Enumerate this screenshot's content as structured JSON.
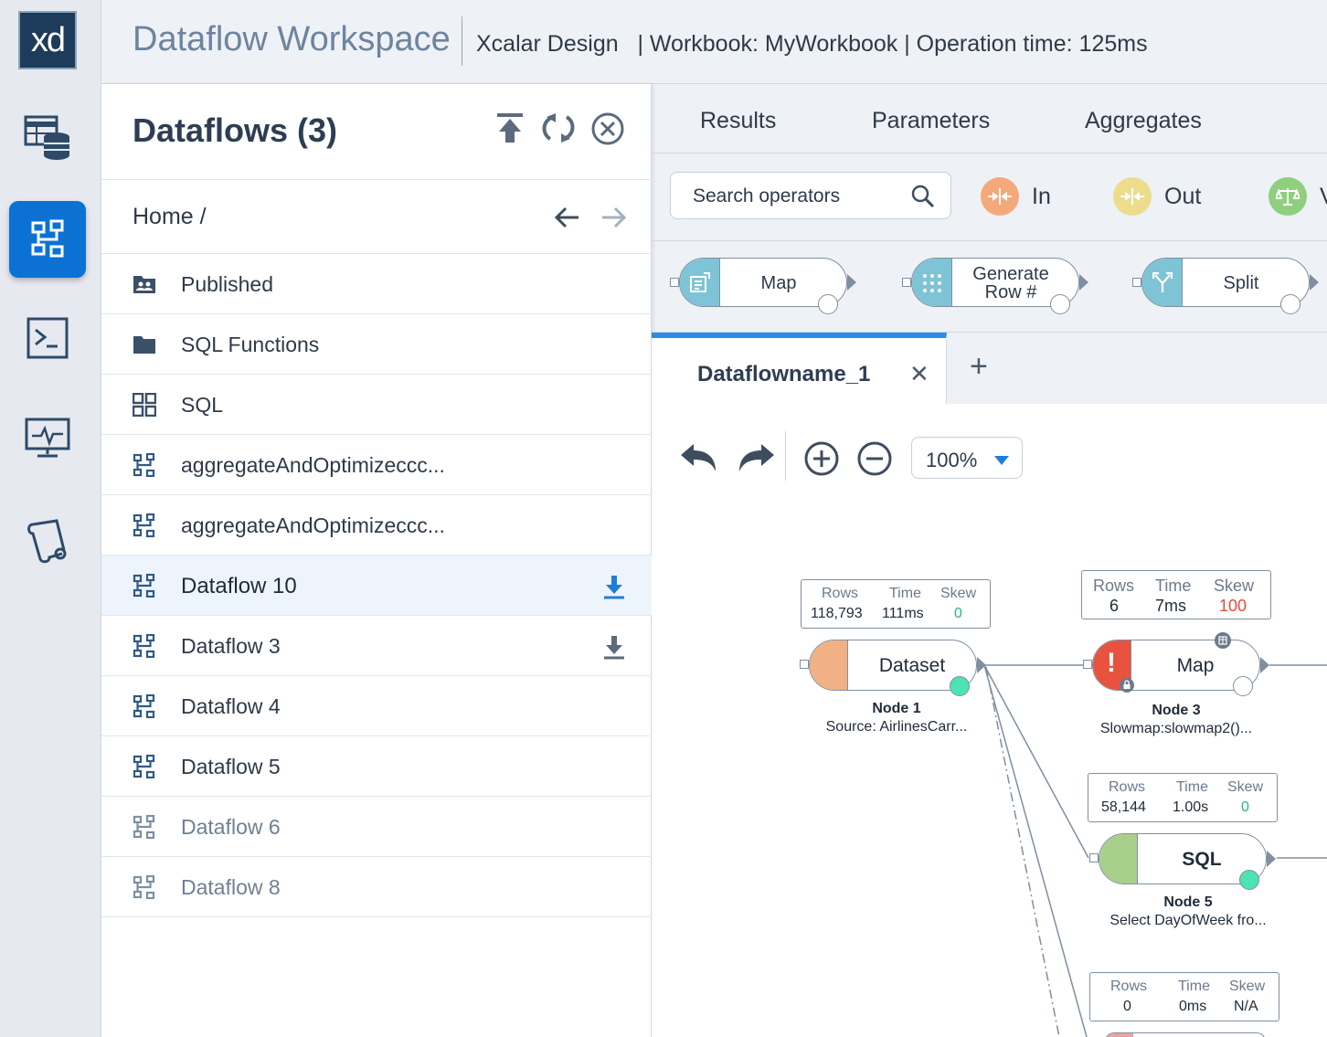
{
  "header": {
    "title": "Dataflow Workspace",
    "meta": "Xcalar Design   | Workbook: MyWorkbook | Operation time: 125ms"
  },
  "rail": {
    "logo": "xd",
    "items": [
      "datasets-icon",
      "dataflow-icon",
      "terminal-icon",
      "monitor-icon",
      "scroll-icon"
    ]
  },
  "panel": {
    "title": "Dataflows (3)",
    "crumb": "Home /",
    "items": [
      {
        "label": "Published",
        "icon": "shared-folder-icon"
      },
      {
        "label": "SQL Functions",
        "icon": "folder-icon"
      },
      {
        "label": "SQL",
        "icon": "grid-icon"
      },
      {
        "label": "aggregateAndOptimizeccc...",
        "icon": "dataflow-icon"
      },
      {
        "label": "aggregateAndOptimizeccc...",
        "icon": "dataflow-icon"
      },
      {
        "label": "Dataflow 10",
        "icon": "dataflow-icon"
      },
      {
        "label": "Dataflow 3",
        "icon": "dataflow-icon"
      },
      {
        "label": "Dataflow 4",
        "icon": "dataflow-icon"
      },
      {
        "label": "Dataflow 5",
        "icon": "dataflow-icon"
      },
      {
        "label": "Dataflow 6",
        "icon": "dataflow-icon"
      },
      {
        "label": "Dataflow 8",
        "icon": "dataflow-icon"
      }
    ]
  },
  "tabs": [
    "Results",
    "Parameters",
    "Aggregates"
  ],
  "toolbar": {
    "search_placeholder": "Search operators",
    "categories": [
      {
        "label": "In",
        "color": "#f5a97a"
      },
      {
        "label": "Out",
        "color": "#ecdc8c"
      },
      {
        "label": "V",
        "color": "#8fcf7e"
      }
    ]
  },
  "operators": [
    {
      "label": "Map"
    },
    {
      "label": "Generate Row #"
    },
    {
      "label": "Split"
    }
  ],
  "dataflow_tab": {
    "name": "Dataflowname_1"
  },
  "zoom": "100%",
  "stat_headers": {
    "rows": "Rows",
    "time": "Time",
    "skew": "Skew"
  },
  "nodes": [
    {
      "name": "Dataset",
      "caption_title": "Node 1",
      "caption_sub": "Source: AirlinesCarr...",
      "rows": "118,793",
      "time": "111ms",
      "skew": "0",
      "color": "#f2b184"
    },
    {
      "name": "Map",
      "caption_title": "Node 3",
      "caption_sub": "Slowmap:slowmap2()...",
      "rows": "6",
      "time": "7ms",
      "skew": "100",
      "color": "#e8533f"
    },
    {
      "name": "SQL",
      "caption_title": "Node 5",
      "caption_sub": "Select DayOfWeek fro...",
      "rows": "58,144",
      "time": "1.00s",
      "skew": "0",
      "color": "#a9cf8c"
    },
    {
      "rows": "0",
      "time": "0ms",
      "skew": "N/A"
    }
  ]
}
